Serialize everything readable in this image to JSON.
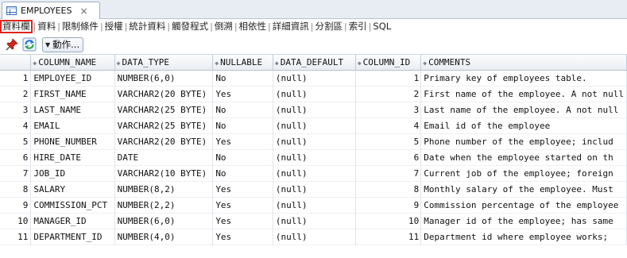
{
  "editor_tab": {
    "title": "EMPLOYEES",
    "close": "×"
  },
  "subtabs": [
    {
      "label": "資料欄",
      "active": true
    },
    {
      "label": "資料",
      "active": false
    },
    {
      "label": "限制條件",
      "active": false
    },
    {
      "label": "授權",
      "active": false
    },
    {
      "label": "統計資料",
      "active": false
    },
    {
      "label": "觸發程式",
      "active": false
    },
    {
      "label": "倒溯",
      "active": false
    },
    {
      "label": "相依性",
      "active": false
    },
    {
      "label": "詳細資訊",
      "active": false
    },
    {
      "label": "分割區",
      "active": false
    },
    {
      "label": "索引",
      "active": false
    },
    {
      "label": "SQL",
      "active": false
    }
  ],
  "toolbar": {
    "pin_icon": "pin-icon",
    "refresh_icon": "refresh-icon",
    "actions_label": "動作..."
  },
  "grid": {
    "columns": [
      "COLUMN_NAME",
      "DATA_TYPE",
      "NULLABLE",
      "DATA_DEFAULT",
      "COLUMN_ID",
      "COMMENTS"
    ],
    "rows": [
      {
        "n": "1",
        "name": "EMPLOYEE_ID",
        "type": "NUMBER(6,0)",
        "nullable": "No",
        "default": "(null)",
        "id": "1",
        "comment": "Primary key of employees table."
      },
      {
        "n": "2",
        "name": "FIRST_NAME",
        "type": "VARCHAR2(20 BYTE)",
        "nullable": "Yes",
        "default": "(null)",
        "id": "2",
        "comment": "First name of the employee. A not null"
      },
      {
        "n": "3",
        "name": "LAST_NAME",
        "type": "VARCHAR2(25 BYTE)",
        "nullable": "No",
        "default": "(null)",
        "id": "3",
        "comment": "Last name of the employee. A not null"
      },
      {
        "n": "4",
        "name": "EMAIL",
        "type": "VARCHAR2(25 BYTE)",
        "nullable": "No",
        "default": "(null)",
        "id": "4",
        "comment": "Email id of the employee"
      },
      {
        "n": "5",
        "name": "PHONE_NUMBER",
        "type": "VARCHAR2(20 BYTE)",
        "nullable": "Yes",
        "default": "(null)",
        "id": "5",
        "comment": "Phone number of the employee; includ"
      },
      {
        "n": "6",
        "name": "HIRE_DATE",
        "type": "DATE",
        "nullable": "No",
        "default": "(null)",
        "id": "6",
        "comment": "Date when the employee started on th"
      },
      {
        "n": "7",
        "name": "JOB_ID",
        "type": "VARCHAR2(10 BYTE)",
        "nullable": "No",
        "default": "(null)",
        "id": "7",
        "comment": "Current job of the employee; foreign"
      },
      {
        "n": "8",
        "name": "SALARY",
        "type": "NUMBER(8,2)",
        "nullable": "Yes",
        "default": "(null)",
        "id": "8",
        "comment": "Monthly salary of the employee. Must"
      },
      {
        "n": "9",
        "name": "COMMISSION_PCT",
        "type": "NUMBER(2,2)",
        "nullable": "Yes",
        "default": "(null)",
        "id": "9",
        "comment": "Commission percentage of the employee"
      },
      {
        "n": "10",
        "name": "MANAGER_ID",
        "type": "NUMBER(6,0)",
        "nullable": "Yes",
        "default": "(null)",
        "id": "10",
        "comment": "Manager id of the employee; has same"
      },
      {
        "n": "11",
        "name": "DEPARTMENT_ID",
        "type": "NUMBER(4,0)",
        "nullable": "Yes",
        "default": "(null)",
        "id": "11",
        "comment": "Department id where employee works;"
      }
    ]
  }
}
